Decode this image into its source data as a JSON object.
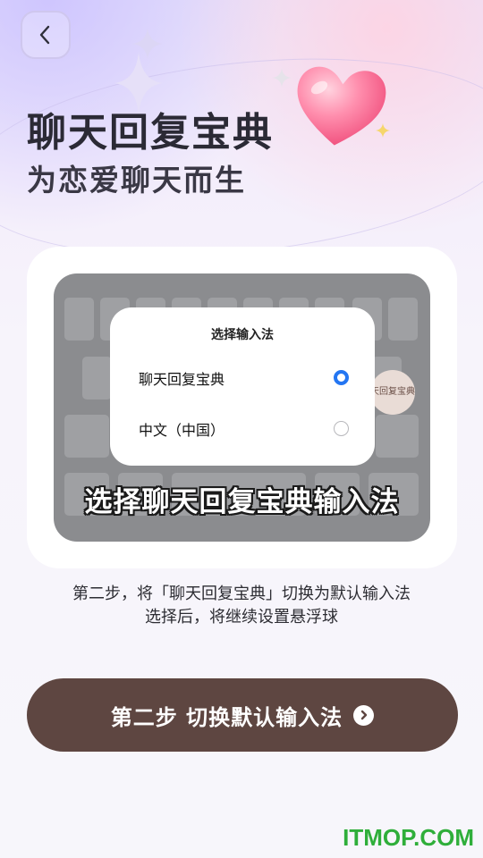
{
  "header": {
    "back_icon": "chevron-left-icon",
    "title": "聊天回复宝典",
    "subtitle": "为恋爱聊天而生"
  },
  "illustration": {
    "dialog_title": "选择输入法",
    "options": [
      {
        "label": "聊天回复宝典",
        "selected": true
      },
      {
        "label": "中文（中国）",
        "selected": false
      }
    ],
    "avatar_text": "天回复宝典",
    "overlay_text": "选择聊天回复宝典输入法"
  },
  "instructions": {
    "line1": "第二步，将「聊天回复宝典」切换为默认输入法",
    "line2": "选择后，将继续设置悬浮球"
  },
  "cta": {
    "label": "第二步 切换默认输入法",
    "icon": "chevron-right-circle-icon"
  },
  "watermark": "ITMOP.COM",
  "colors": {
    "cta_bg": "#5e4641",
    "radio_active": "#2476f2",
    "watermark": "#2fae3a",
    "keyboard_bg": "#8b8c8f"
  }
}
